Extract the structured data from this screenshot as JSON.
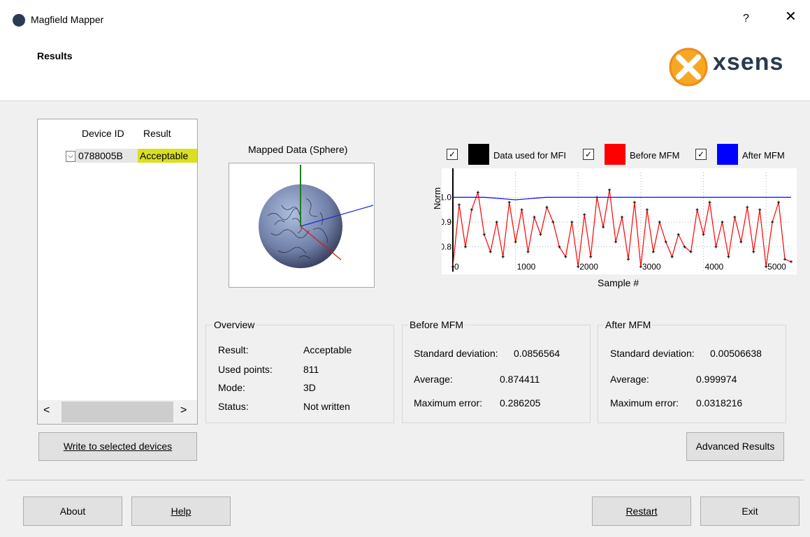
{
  "window": {
    "title": "Magfield Mapper",
    "help": "?",
    "close": "✕"
  },
  "header": {
    "title": "Results",
    "logo_text": "xsens"
  },
  "device_table": {
    "columns": [
      "Device ID",
      "Result"
    ],
    "rows": [
      {
        "device_id": "0788005B",
        "result": "Acceptable",
        "checked": true
      }
    ],
    "scroll_left": "<",
    "scroll_right": ">"
  },
  "sphere": {
    "label": "Mapped Data (Sphere)"
  },
  "chart_legend": [
    {
      "label": "Data used for MFI",
      "color": "#000000",
      "checked": true
    },
    {
      "label": "Before MFM",
      "color": "#ff0000",
      "checked": true
    },
    {
      "label": "After MFM",
      "color": "#0000ff",
      "checked": true
    }
  ],
  "chart_data": {
    "type": "line",
    "title": "",
    "xlabel": "Sample #",
    "ylabel": "Norm",
    "xlim": [
      0,
      5400
    ],
    "ylim": [
      0.7,
      1.1
    ],
    "x_ticks": [
      "0",
      "1000",
      "2000",
      "3000",
      "4000",
      "5000"
    ],
    "y_ticks": [
      "0.8",
      "0.9",
      "1.0"
    ],
    "grid": true,
    "series": [
      {
        "name": "After MFM",
        "color": "#0000ff",
        "x": [
          0,
          500,
          1000,
          1500,
          2000,
          2500,
          3000,
          3500,
          4000,
          4500,
          5000,
          5400
        ],
        "y": [
          1.0,
          1.0,
          0.99,
          1.0,
          1.0,
          1.0,
          1.0,
          1.0,
          1.0,
          1.0,
          1.0,
          1.0
        ]
      },
      {
        "name": "Before MFM",
        "color": "#ff0000",
        "x": [
          0,
          100,
          200,
          300,
          400,
          500,
          600,
          700,
          800,
          900,
          1000,
          1100,
          1200,
          1300,
          1400,
          1500,
          1600,
          1700,
          1800,
          1900,
          2000,
          2100,
          2200,
          2300,
          2400,
          2500,
          2600,
          2700,
          2800,
          2900,
          3000,
          3100,
          3200,
          3300,
          3400,
          3500,
          3600,
          3700,
          3800,
          3900,
          4000,
          4100,
          4200,
          4300,
          4400,
          4500,
          4600,
          4700,
          4800,
          4900,
          5000,
          5100,
          5200,
          5300,
          5400
        ],
        "y": [
          0.72,
          0.97,
          0.8,
          0.95,
          1.02,
          0.85,
          0.78,
          0.9,
          0.76,
          0.98,
          0.82,
          0.95,
          0.78,
          0.92,
          0.85,
          0.96,
          0.9,
          0.8,
          0.76,
          0.9,
          0.72,
          0.93,
          0.76,
          1.0,
          0.88,
          1.03,
          0.82,
          0.92,
          0.75,
          0.98,
          0.72,
          0.95,
          0.78,
          0.9,
          0.82,
          0.76,
          0.85,
          0.8,
          0.78,
          0.95,
          0.85,
          0.98,
          0.8,
          0.9,
          0.76,
          0.92,
          0.82,
          0.96,
          0.78,
          0.95,
          0.72,
          0.9,
          0.98,
          0.75,
          0.74
        ]
      }
    ]
  },
  "overview": {
    "title": "Overview",
    "result_label": "Result:",
    "result_value": "Acceptable",
    "points_label": "Used points:",
    "points_value": "811",
    "mode_label": "Mode:",
    "mode_value": "3D",
    "status_label": "Status:",
    "status_value": "Not written"
  },
  "before": {
    "title": "Before MFM",
    "std_label": "Standard deviation:",
    "std_value": "0.0856564",
    "avg_label": "Average:",
    "avg_value": "0.874411",
    "max_label": "Maximum error:",
    "max_value": "0.286205"
  },
  "after": {
    "title": "After MFM",
    "std_label": "Standard deviation:",
    "std_value": "0.00506638",
    "avg_label": "Average:",
    "avg_value": "0.999974",
    "max_label": "Maximum error:",
    "max_value": "0.0318216"
  },
  "buttons": {
    "write": "Write to selected devices",
    "advanced": "Advanced Results",
    "about": "About",
    "help": "Help",
    "restart": "Restart",
    "exit": "Exit"
  }
}
